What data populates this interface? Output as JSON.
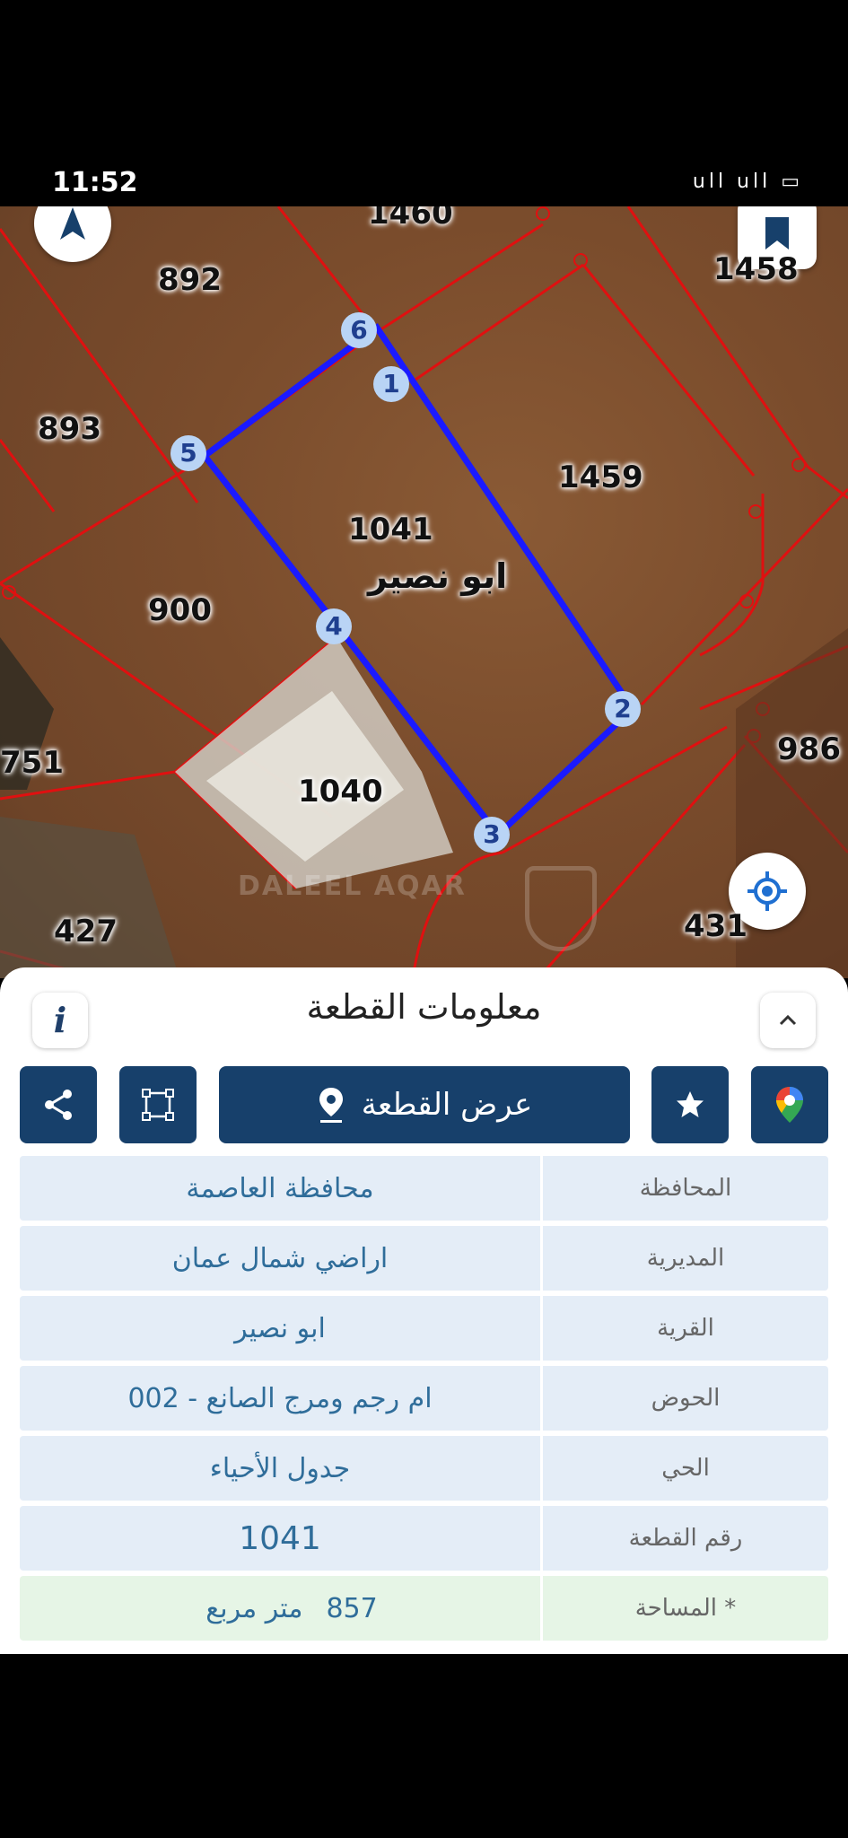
{
  "status_bar": {
    "time": "11:52",
    "icons": "ull ull ▭"
  },
  "map": {
    "plots": {
      "p1460": "1460",
      "p892": "892",
      "p1458": "1458",
      "p893": "893",
      "p1459": "1459",
      "p1041": "1041",
      "village_label": "ابو نصير",
      "p900": "900",
      "p751": "751",
      "p986": "986",
      "p1040": "1040",
      "p427": "427",
      "p431": "431"
    },
    "vertices": {
      "v1": "1",
      "v2": "2",
      "v3": "3",
      "v4": "4",
      "v5": "5",
      "v6": "6"
    },
    "watermark": "DALEEL AQAR",
    "colors": {
      "selected_boundary": "#1a1aff",
      "parcel_lines": "#e01010"
    }
  },
  "panel": {
    "title": "معلومات القطعة",
    "info_icon": "i",
    "show_plot_label": "عرض القطعة",
    "rows": [
      {
        "label": "المحافظة",
        "value": "محافظة العاصمة"
      },
      {
        "label": "المديرية",
        "value": "اراضي شمال عمان"
      },
      {
        "label": "القرية",
        "value": "ابو نصير"
      },
      {
        "label": "الحوض",
        "value": "ام رجم ومرج الصانع - 002"
      },
      {
        "label": "الحي",
        "value": "جدول الأحياء"
      },
      {
        "label": "رقم القطعة",
        "value": "1041"
      },
      {
        "label": "المساحة *",
        "value": "857",
        "unit": "متر مربع"
      }
    ],
    "colors": {
      "primary_button": "#17406b",
      "row_bg": "#e4edf7",
      "area_row_bg": "#e6f5e6"
    }
  }
}
